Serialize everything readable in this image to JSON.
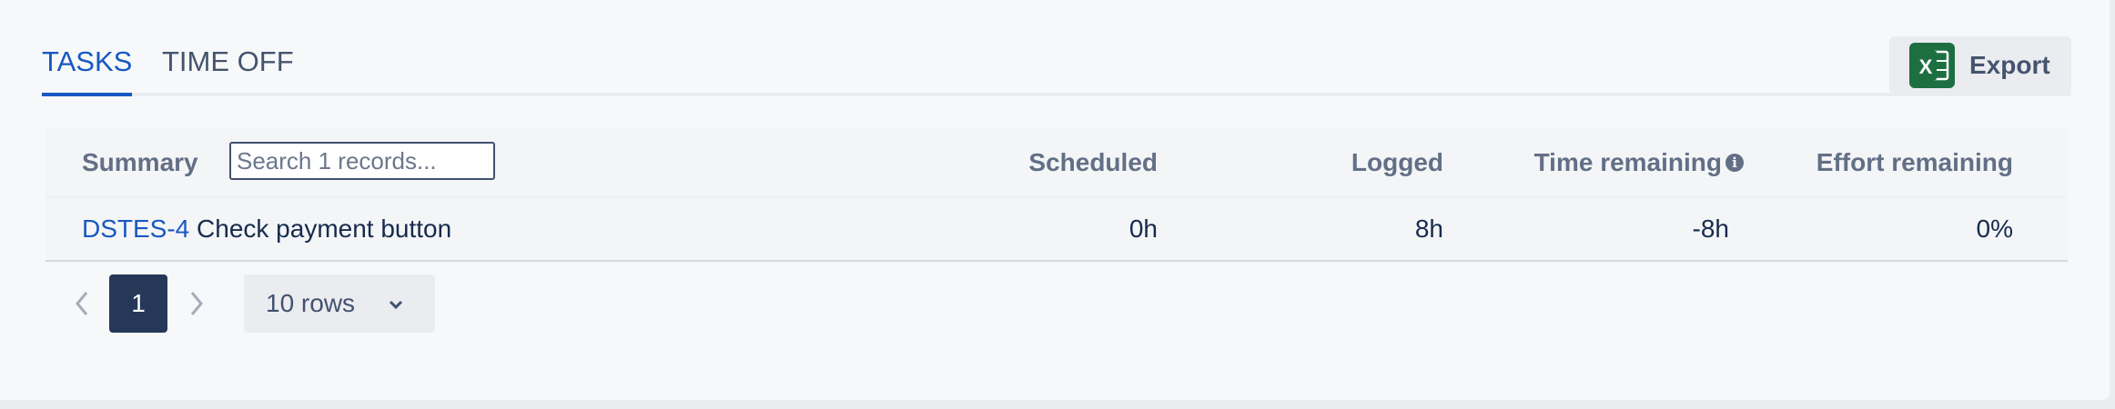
{
  "tabs": [
    {
      "label": "TASKS",
      "active": true
    },
    {
      "label": "TIME OFF",
      "active": false
    }
  ],
  "export": {
    "label": "Export",
    "icon": "excel-icon",
    "icon_letter": "X"
  },
  "table": {
    "headers": {
      "summary": "Summary",
      "scheduled": "Scheduled",
      "logged": "Logged",
      "time_remaining": "Time remaining",
      "effort_remaining": "Effort remaining"
    },
    "search_placeholder": "Search 1 records...",
    "rows": [
      {
        "key": "DSTES-4",
        "title": "Check payment button",
        "scheduled": "0h",
        "logged": "8h",
        "time_remaining": "-8h",
        "effort_remaining": "0%"
      }
    ]
  },
  "pagination": {
    "current_page": "1",
    "rows_per_page": "10 rows"
  },
  "colors": {
    "accent": "#1858c0",
    "excel_green": "#1d6f42",
    "page_active": "#253858"
  }
}
